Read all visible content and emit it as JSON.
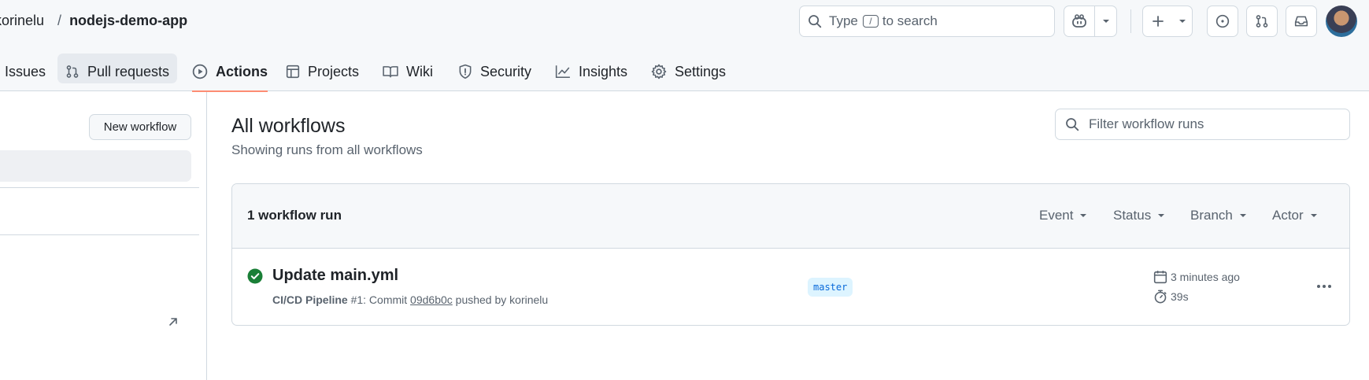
{
  "header": {
    "owner": "korinelu",
    "separator": "/",
    "repo": "nodejs-demo-app",
    "search": {
      "prefix": "Type",
      "key": "/",
      "suffix": "to search"
    }
  },
  "tabs": [
    {
      "label": "Issues",
      "icon": "issue-icon"
    },
    {
      "label": "Pull requests",
      "icon": "pull-request-icon"
    },
    {
      "label": "Actions",
      "icon": "play-icon",
      "active": true
    },
    {
      "label": "Projects",
      "icon": "table-icon"
    },
    {
      "label": "Wiki",
      "icon": "book-icon"
    },
    {
      "label": "Security",
      "icon": "shield-icon"
    },
    {
      "label": "Insights",
      "icon": "graph-icon"
    },
    {
      "label": "Settings",
      "icon": "gear-icon"
    }
  ],
  "sidebar": {
    "new_workflow_label": "New workflow"
  },
  "main": {
    "title": "All workflows",
    "subtitle": "Showing runs from all workflows",
    "filter_placeholder": "Filter workflow runs",
    "run_count": "1 workflow run",
    "filters": [
      "Event",
      "Status",
      "Branch",
      "Actor"
    ]
  },
  "runs": [
    {
      "title": "Update main.yml",
      "workflow": "CI/CD Pipeline",
      "run_number": "#1",
      "commit_prefix": ": Commit",
      "sha": "09d6b0c",
      "pushed_by": "pushed by korinelu",
      "branch": "master",
      "time_ago": "3 minutes ago",
      "duration": "39s",
      "status": "success"
    }
  ],
  "colors": {
    "accent_underline": "#fd8c73",
    "success": "#1a7f37",
    "branch_bg": "#ddf4ff",
    "branch_text": "#0969da"
  }
}
